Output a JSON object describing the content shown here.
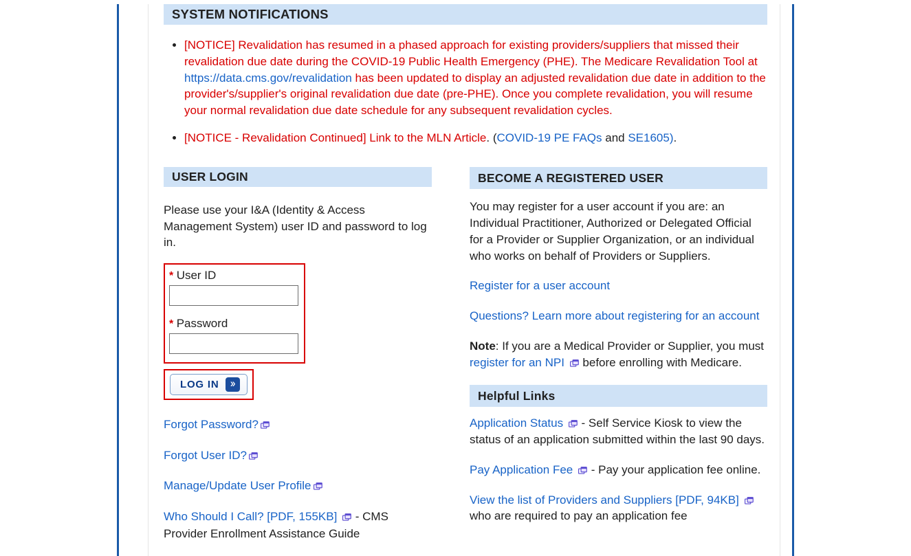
{
  "sections": {
    "system_notifications": "SYSTEM NOTIFICATIONS",
    "user_login": "USER LOGIN",
    "become_registered": "BECOME A REGISTERED USER",
    "helpful_links": "Helpful Links"
  },
  "notices": {
    "n1_prefix": "[NOTICE] Revalidation has resumed in a phased approach for existing providers/suppliers that missed their revalidation due date during the COVID-19 Public Health Emergency (PHE). The Medicare Revalidation Tool at ",
    "n1_link": "https://data.cms.gov/revalidation",
    "n1_suffix": " has been updated to display an adjusted revalidation due date in addition to the provider's/supplier's original revalidation due date (pre-PHE). Once you complete revalidation, you will resume your normal revalidation due date schedule for any subsequent revalidation cycles.",
    "n2_prefix": "[NOTICE - Revalidation Continued] Link to the MLN Article",
    "n2_after": ". (",
    "n2_link1": "COVID-19 PE FAQs",
    "n2_and": " and ",
    "n2_link2": "SE1605",
    "n2_close": ")",
    "n2_period": "."
  },
  "login": {
    "intro": "Please use your I&A (Identity & Access Management System) user ID and password to log in.",
    "user_id_label": "User ID",
    "password_label": "Password",
    "login_button": "LOG IN"
  },
  "login_links": {
    "forgot_password": "Forgot Password?",
    "forgot_userid": "Forgot User ID?",
    "manage_profile": "Manage/Update User Profile",
    "who_call": "Who Should I Call? [PDF, 155KB]",
    "who_call_desc": " - CMS Provider Enrollment Assistance Guide"
  },
  "register": {
    "intro": "You may register for a user account if you are: an Individual Practitioner, Authorized or Delegated Official for a Provider or Supplier Organization, or an individual who works on behalf of Providers or Suppliers.",
    "register_link": "Register for a user account",
    "questions_link": "Questions? Learn more about registering for an account",
    "note_label": "Note",
    "note_text": ": If you are a Medical Provider or Supplier, you must ",
    "npi_link": "register for an NPI",
    "note_suffix": " before enrolling with Medicare."
  },
  "helpful_links": {
    "app_status_link": "Application Status",
    "app_status_desc": " - Self Service Kiosk to view the status of an application submitted within the last 90 days.",
    "pay_fee_link": "Pay Application Fee",
    "pay_fee_desc": " - Pay your application fee online.",
    "view_list_link": "View the list of Providers and Suppliers [PDF, 94KB]",
    "view_list_desc": " who are required to pay an application fee"
  }
}
